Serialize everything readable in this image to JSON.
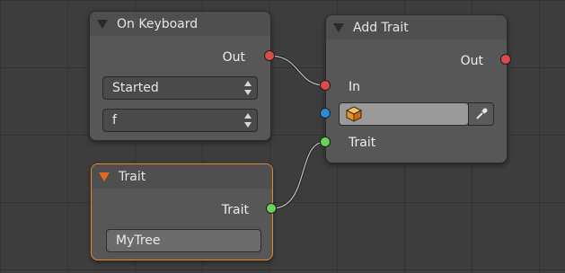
{
  "colors": {
    "background": "#3d3d3d",
    "node_body": "#575757",
    "selected_outline": "#e58a2c",
    "socket_exec": "#d94c4c",
    "socket_object": "#2b8bd6",
    "socket_trait": "#6ad15a"
  },
  "nodes": {
    "on_keyboard": {
      "title": "On Keyboard",
      "out_label": "Out",
      "event_select": "Started",
      "key_select": "f"
    },
    "add_trait": {
      "title": "Add Trait",
      "out_label": "Out",
      "in_label": "In",
      "object_icon": "cube-object-icon",
      "picker_icon": "eyedropper-icon",
      "trait_label": "Trait"
    },
    "trait": {
      "title": "Trait",
      "out_label": "Trait",
      "name_value": "MyTree"
    }
  }
}
